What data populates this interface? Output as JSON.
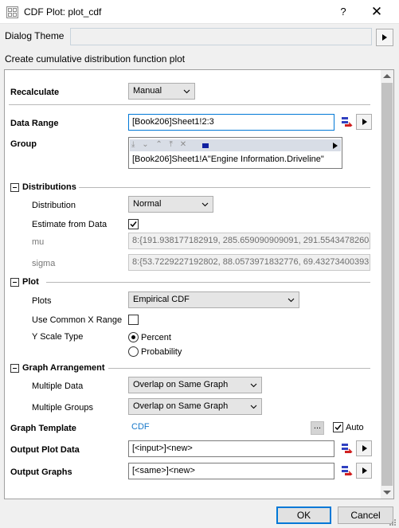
{
  "window": {
    "title": "CDF Plot: plot_cdf",
    "help_label": "?",
    "close_label": "✕"
  },
  "theme": {
    "label": "Dialog Theme",
    "value": "",
    "arrow_icon": "play-arrow-icon"
  },
  "description": "Create cumulative distribution function plot",
  "recalculate": {
    "label": "Recalculate",
    "value": "Manual"
  },
  "data_range": {
    "label": "Data Range",
    "value": "[Book206]Sheet1!2:3"
  },
  "group": {
    "label": "Group",
    "value": "[Book206]Sheet1!A\"Engine Information.Driveline\""
  },
  "distributions": {
    "section_label": "Distributions",
    "distribution_label": "Distribution",
    "distribution_value": "Normal",
    "estimate_label": "Estimate from Data",
    "estimate_checked": true,
    "mu_label": "mu",
    "mu_value": "8:{191.938177182919, 285.659090909091, 291.55434782608",
    "sigma_label": "sigma",
    "sigma_value": "8:{53.7229227192802, 88.0573971832776, 69.43273400393"
  },
  "plot": {
    "section_label": "Plot",
    "plots_label": "Plots",
    "plots_value": "Empirical CDF",
    "common_x_label": "Use Common X Range",
    "common_x_checked": false,
    "yscale_label": "Y Scale Type",
    "yscale_options": [
      "Percent",
      "Probability"
    ],
    "yscale_selected": "Percent"
  },
  "arrangement": {
    "section_label": "Graph Arrangement",
    "multiple_data_label": "Multiple Data",
    "multiple_data_value": "Overlap on Same Graph",
    "multiple_groups_label": "Multiple Groups",
    "multiple_groups_value": "Overlap on Same Graph"
  },
  "template": {
    "label": "Graph Template",
    "value": "CDF",
    "dots_label": "...",
    "auto_label": "Auto",
    "auto_checked": true
  },
  "output_plot_data": {
    "label": "Output Plot Data",
    "value": "[<input>]<new>"
  },
  "output_graphs": {
    "label": "Output Graphs",
    "value": "[<same>]<new>"
  },
  "buttons": {
    "ok": "OK",
    "cancel": "Cancel"
  },
  "colors": {
    "accent": "#0078d7",
    "link": "#1979ca",
    "panel_bg": "#ffffff",
    "dialog_bg": "#f0f0f0"
  }
}
